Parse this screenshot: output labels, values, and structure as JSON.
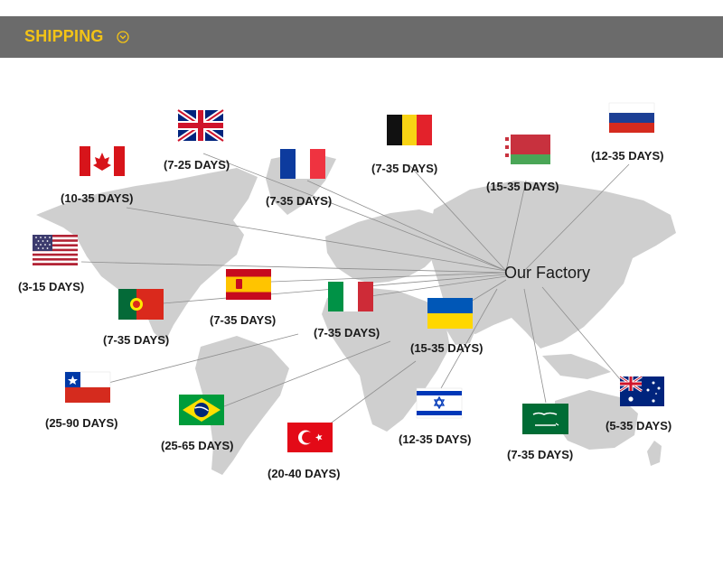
{
  "header": {
    "title": "SHIPPING",
    "icon": "chevron-down-circle-icon",
    "background": "#6b6b6b",
    "accent": "#f3c316"
  },
  "hub_label": "Our Factory",
  "destinations": [
    {
      "country": "Canada",
      "flag_icon": "canada-flag-icon",
      "days": "(10-35 DAYS)"
    },
    {
      "country": "United Kingdom",
      "flag_icon": "uk-flag-icon",
      "days": "(7-25 DAYS)"
    },
    {
      "country": "France",
      "flag_icon": "france-flag-icon",
      "days": "(7-35 DAYS)"
    },
    {
      "country": "Belgium",
      "flag_icon": "belgium-flag-icon",
      "days": "(7-35 DAYS)"
    },
    {
      "country": "Belarus",
      "flag_icon": "belarus-flag-icon",
      "days": "(15-35 DAYS)"
    },
    {
      "country": "Russia",
      "flag_icon": "russia-flag-icon",
      "days": "(12-35 DAYS)"
    },
    {
      "country": "United States",
      "flag_icon": "usa-flag-icon",
      "days": "(3-15 DAYS)"
    },
    {
      "country": "Spain",
      "flag_icon": "spain-flag-icon",
      "days": "(7-35 DAYS)"
    },
    {
      "country": "Portugal",
      "flag_icon": "portugal-flag-icon",
      "days": "(7-35 DAYS)"
    },
    {
      "country": "Italy",
      "flag_icon": "italy-flag-icon",
      "days": "(7-35 DAYS)"
    },
    {
      "country": "Ukraine",
      "flag_icon": "ukraine-flag-icon",
      "days": "(15-35 DAYS)"
    },
    {
      "country": "Chile",
      "flag_icon": "chile-flag-icon",
      "days": "(25-90 DAYS)"
    },
    {
      "country": "Brazil",
      "flag_icon": "brazil-flag-icon",
      "days": "(25-65 DAYS)"
    },
    {
      "country": "Turkey",
      "flag_icon": "turkey-flag-icon",
      "days": "(20-40 DAYS)"
    },
    {
      "country": "Israel",
      "flag_icon": "israel-flag-icon",
      "days": "(12-35 DAYS)"
    },
    {
      "country": "Saudi Arabia",
      "flag_icon": "saudi-arabia-flag-icon",
      "days": "(7-35 DAYS)"
    },
    {
      "country": "Australia",
      "flag_icon": "australia-flag-icon",
      "days": "(5-35 DAYS)"
    }
  ]
}
